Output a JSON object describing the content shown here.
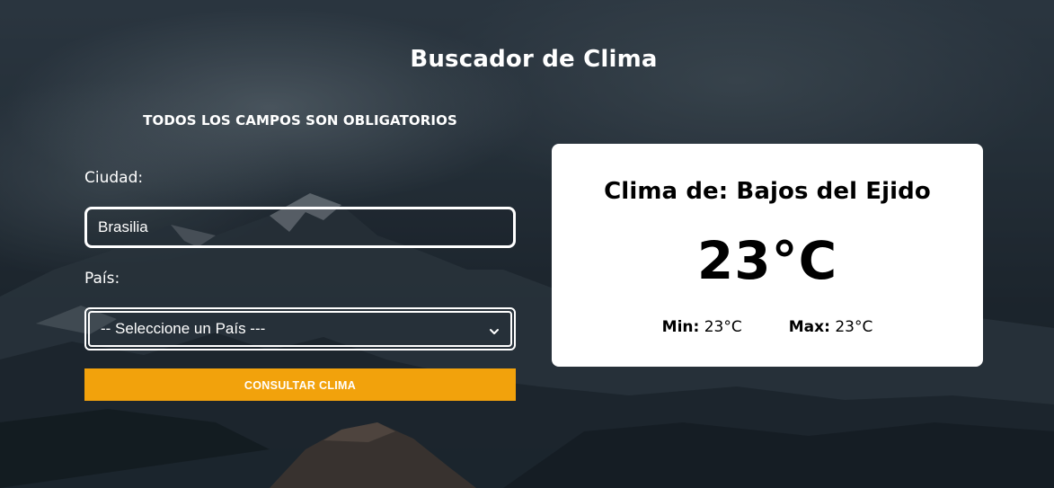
{
  "page": {
    "title": "Buscador de Clima"
  },
  "form": {
    "required_note": "TODOS LOS CAMPOS SON OBLIGATORIOS",
    "city_label": "Ciudad:",
    "city_value": "Brasilia",
    "country_label": "País:",
    "country_selected": "-- Seleccione un País ---",
    "submit_label": "CONSULTAR CLIMA"
  },
  "result": {
    "title": "Clima de: Bajos del Ejido",
    "temperature": "23°C",
    "min_label": "Min:",
    "min_value": "23°C",
    "max_label": "Max:",
    "max_value": "23°C"
  },
  "colors": {
    "accent": "#f2a20c",
    "card_bg": "#ffffff",
    "text_light": "#ffffff",
    "text_dark": "#000000"
  },
  "icons": {
    "select_chevron": "chevron-down-icon"
  }
}
